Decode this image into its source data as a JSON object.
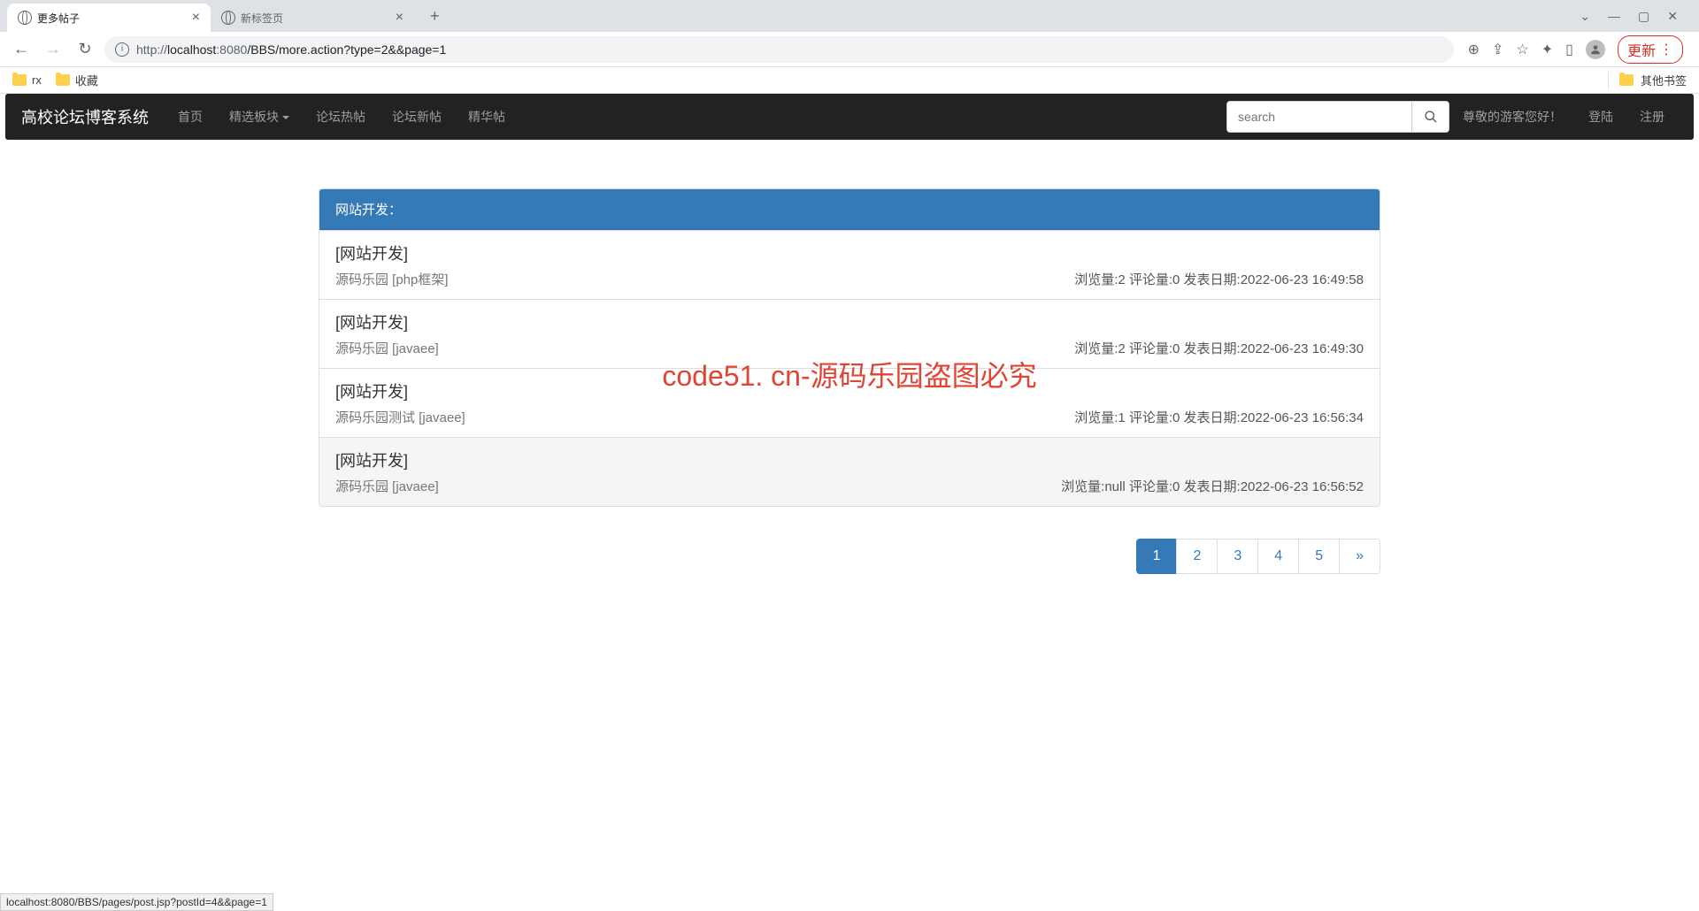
{
  "browser": {
    "tabs": [
      {
        "title": "更多帖子",
        "active": true
      },
      {
        "title": "新标签页",
        "active": false
      }
    ],
    "url_host": "localhost",
    "url_port": ":8080",
    "url_path": "/BBS/more.action?type=2&&page=1",
    "url_prefix": "http://",
    "update_label": "更新",
    "bookmarks": [
      {
        "label": "rx"
      },
      {
        "label": "收藏"
      }
    ],
    "other_bookmarks": "其他书签",
    "status_bar": "localhost:8080/BBS/pages/post.jsp?postId=4&&page=1"
  },
  "navbar": {
    "brand": "高校论坛博客系统",
    "items": [
      "首页",
      "精选板块",
      "论坛热帖",
      "论坛新帖",
      "精华帖"
    ],
    "search_placeholder": "search",
    "guest_text": "尊敬的游客您好！",
    "login": "登陆",
    "register": "注册"
  },
  "panel": {
    "heading": "网站开发：",
    "posts": [
      {
        "title": "[网站开发]",
        "author": "源码乐园 [php框架]",
        "views": "2",
        "comments": "0",
        "date": "2022-06-23 16:49:58",
        "bg_gray": false
      },
      {
        "title": "[网站开发]",
        "author": "源码乐园 [javaee]",
        "views": "2",
        "comments": "0",
        "date": "2022-06-23 16:49:30",
        "bg_gray": false
      },
      {
        "title": "[网站开发]",
        "author": "源码乐园测试 [javaee]",
        "views": "1",
        "comments": "0",
        "date": "2022-06-23 16:56:34",
        "bg_gray": false
      },
      {
        "title": "[网站开发]",
        "author": "源码乐园 [javaee]",
        "views": "null",
        "comments": "0",
        "date": "2022-06-23 16:56:52",
        "bg_gray": true
      }
    ]
  },
  "labels": {
    "views": "浏览量:",
    "comments": " 评论量:",
    "date": " 发表日期:"
  },
  "pagination": {
    "pages": [
      "1",
      "2",
      "3",
      "4",
      "5"
    ],
    "next": "»",
    "active": 0
  },
  "watermark": "code51. cn-源码乐园盗图必究"
}
